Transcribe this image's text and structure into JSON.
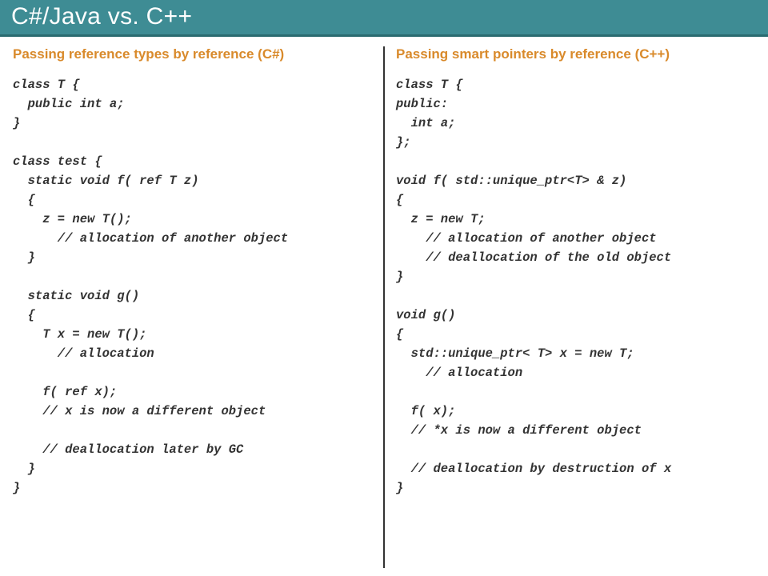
{
  "title": "C#/Java vs. C++",
  "left": {
    "heading": "Passing reference types by reference (C#)",
    "code": "class T {\n  public int a;\n}\n\nclass test {\n  static void f( ref T z)\n  {\n    z = new T();\n      // allocation of another object\n  }\n\n  static void g()\n  {\n    T x = new T();\n      // allocation\n\n    f( ref x);\n    // x is now a different object\n\n    // deallocation later by GC\n  }\n}"
  },
  "right": {
    "heading": "Passing smart pointers by reference (C++)",
    "code": "class T {\npublic:\n  int a;\n};\n\nvoid f( std::unique_ptr<T> & z)\n{\n  z = new T;\n    // allocation of another object\n    // deallocation of the old object\n}\n\nvoid g()\n{\n  std::unique_ptr< T> x = new T;\n    // allocation\n\n  f( x);\n  // *x is now a different object\n\n  // deallocation by destruction of x\n}"
  }
}
